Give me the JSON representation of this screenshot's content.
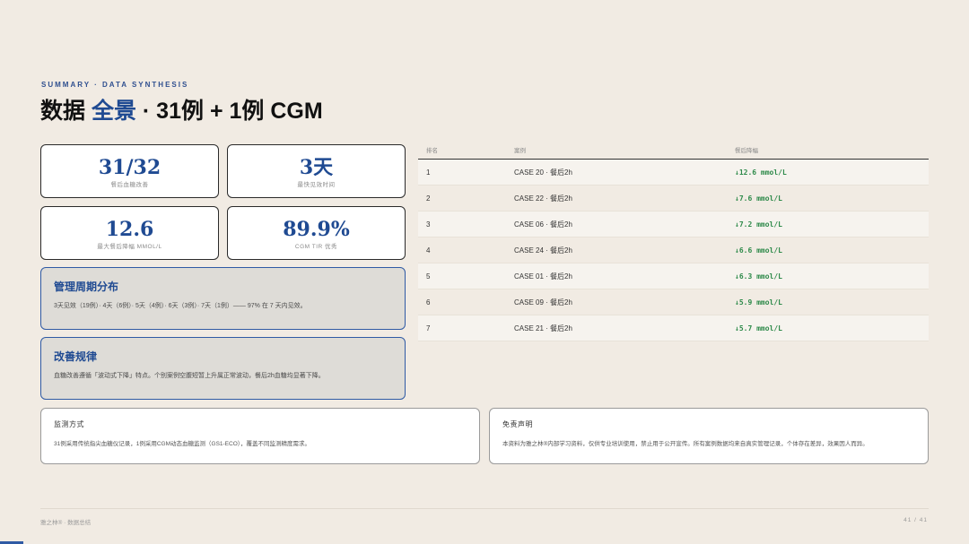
{
  "header": {
    "eyebrow": "SUMMARY · DATA SYNTHESIS",
    "title_pre": "数据 ",
    "title_accent": "全景",
    "title_post": " · 31例 + 1例 CGM"
  },
  "stats": [
    {
      "value": "31/32",
      "label": "餐后血糖改善"
    },
    {
      "value": "3天",
      "label": "最快见效时间"
    },
    {
      "value": "12.6",
      "label": "最大餐后降幅 MMOL/L"
    },
    {
      "value": "89.9%",
      "label": "CGM TIR 优秀"
    }
  ],
  "panels": [
    {
      "title": "管理周期分布",
      "text": "3天见效（19例）· 4天（6例）· 5天（4例）· 6天（3例）· 7天（1例）—— 97% 在 7 天内见效。"
    },
    {
      "title": "改善规律",
      "text": "血糖改善遵循「波动式下降」特点。个别案例空腹短暂上升属正常波动，餐后2h血糖均显著下降。"
    }
  ],
  "notes": [
    {
      "title": "监测方式",
      "text": "31例采用传统指尖血糖仪记录，1例采用CGM动态血糖监测（GS1-ECO），覆盖不同监测精度需求。"
    },
    {
      "title": "免责声明",
      "text": "本资料为雅之林®内部学习资料，仅供专业培训使用，禁止用于公开宣传。所有案例数据均来自真实管理记录，个体存在差异，效果因人而异。"
    }
  ],
  "table": {
    "headers": [
      "排名",
      "案例",
      "餐后降幅"
    ],
    "rows": [
      {
        "rank": "1",
        "case": "CASE 20 · 餐后2h",
        "drop": "↓12.6 mmol/L"
      },
      {
        "rank": "2",
        "case": "CASE 22 · 餐后2h",
        "drop": "↓7.6 mmol/L"
      },
      {
        "rank": "3",
        "case": "CASE 06 · 餐后2h",
        "drop": "↓7.2 mmol/L"
      },
      {
        "rank": "4",
        "case": "CASE 24 · 餐后2h",
        "drop": "↓6.6 mmol/L"
      },
      {
        "rank": "5",
        "case": "CASE 01 · 餐后2h",
        "drop": "↓6.3 mmol/L"
      },
      {
        "rank": "6",
        "case": "CASE 09 · 餐后2h",
        "drop": "↓5.9 mmol/L"
      },
      {
        "rank": "7",
        "case": "CASE 21 · 餐后2h",
        "drop": "↓5.7 mmol/L"
      }
    ]
  },
  "footer": {
    "left": "雅之林® · 数据总结",
    "right": "41 / 41"
  },
  "colors": {
    "accent": "#1f4a92",
    "positive": "#2e8a4a",
    "background": "#f1ebe3"
  }
}
